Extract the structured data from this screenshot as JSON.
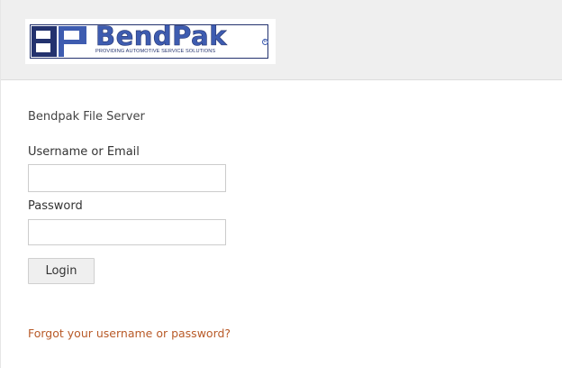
{
  "header": {
    "logo": {
      "monogram": "BP",
      "wordmark": "BendPak",
      "registered": "R",
      "tagline": "PROVIDING AUTOMOTIVE SERVICE SOLUTIONS",
      "colors": {
        "navy": "#23326e",
        "blue": "#3e5cb0"
      }
    }
  },
  "login": {
    "site_title": "Bendpak File Server",
    "username_label": "Username or Email",
    "username_value": "",
    "password_label": "Password",
    "password_value": "",
    "login_label": "Login",
    "forgot_link": "Forgot your username or password?"
  },
  "colors": {
    "header_bg": "#efefef",
    "link": "#b85a28",
    "button_bg": "#efefef"
  }
}
